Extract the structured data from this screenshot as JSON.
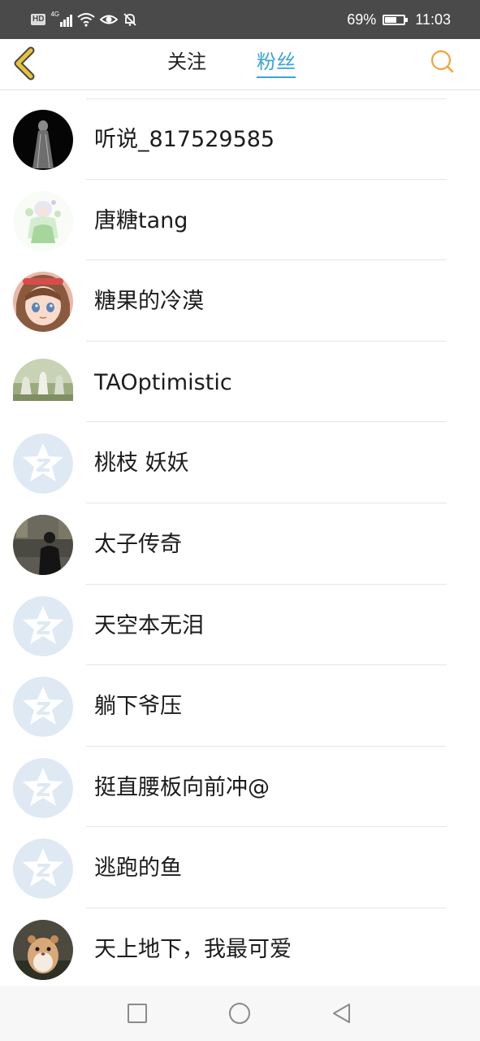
{
  "status_bar": {
    "left_icons": [
      "hd-icon",
      "signal-4g-icon",
      "wifi-icon",
      "eye-icon",
      "mute-bell-icon"
    ],
    "hd_text": "HD",
    "network_text": "4G",
    "battery_percent": "69%",
    "battery_level": 0.69,
    "time": "11:03"
  },
  "header": {
    "back_icon": "chevron-left-icon",
    "tabs": [
      {
        "label": "关注",
        "active": false
      },
      {
        "label": "粉丝",
        "active": true
      }
    ],
    "search_icon": "search-icon",
    "accent_color": "#3ba3d8",
    "back_color": "#e0b020",
    "search_color": "#f2a33a"
  },
  "fans": [
    {
      "name": "听说_817529585",
      "avatar": "dark-figure-avatar"
    },
    {
      "name": "唐糖tang",
      "avatar": "anime-fairy-avatar"
    },
    {
      "name": "糖果的冷漠",
      "avatar": "anime-girl-avatar"
    },
    {
      "name": "TAOptimistic",
      "avatar": "statue-scene-avatar"
    },
    {
      "name": "桃枝 妖妖",
      "avatar": "default-qq-avatar"
    },
    {
      "name": "太子传奇",
      "avatar": "man-street-avatar"
    },
    {
      "name": "天空本无泪",
      "avatar": "default-qq-avatar"
    },
    {
      "name": "躺下爷压",
      "avatar": "default-qq-avatar"
    },
    {
      "name": "挺直腰板向前冲@",
      "avatar": "default-qq-avatar"
    },
    {
      "name": "逃跑的鱼",
      "avatar": "default-qq-avatar"
    },
    {
      "name": "天上地下，我最可爱",
      "avatar": "hamster-avatar"
    }
  ],
  "nav_bar": {
    "buttons": [
      "recent-apps-icon",
      "home-icon",
      "back-triangle-icon"
    ]
  }
}
